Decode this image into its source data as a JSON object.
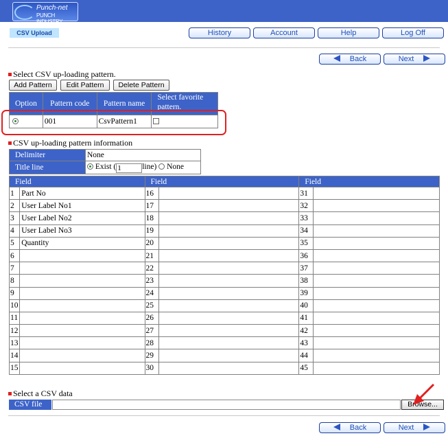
{
  "header": {
    "logo_line1": "Punch-net",
    "logo_line2": "PUNCH INDUSTRY",
    "page_tag": "CSV Upload"
  },
  "nav": {
    "history": "History",
    "account": "Account",
    "help": "Help",
    "logout": "Log Off"
  },
  "pager": {
    "back": "Back",
    "next": "Next"
  },
  "pattern_section": {
    "heading": "Select CSV up-loading pattern.",
    "buttons": {
      "add": "Add Pattern",
      "edit": "Edit Pattern",
      "delete": "Delete Pattern"
    },
    "headers": {
      "option": "Option",
      "code": "Pattern code",
      "name": "Pattern name",
      "favorite": "Select favorite pattern."
    },
    "row": {
      "code": "001",
      "name": "CsvPattern1"
    }
  },
  "info_section": {
    "heading": "CSV up-loading pattern information",
    "delimiter_label": "Delimiter",
    "delimiter_value": "None",
    "title_label": "Title line",
    "exist_label": "Exist (",
    "title_lines": "1",
    "line_suffix": "line)",
    "none_label": "None",
    "field_header": "Field",
    "col1": [
      {
        "n": "1",
        "v": "Part No"
      },
      {
        "n": "2",
        "v": "User Label No1"
      },
      {
        "n": "3",
        "v": "User Label No2"
      },
      {
        "n": "4",
        "v": "User Label No3"
      },
      {
        "n": "5",
        "v": "Quantity"
      },
      {
        "n": "6",
        "v": ""
      },
      {
        "n": "7",
        "v": ""
      },
      {
        "n": "8",
        "v": ""
      },
      {
        "n": "9",
        "v": ""
      },
      {
        "n": "10",
        "v": ""
      },
      {
        "n": "11",
        "v": ""
      },
      {
        "n": "12",
        "v": ""
      },
      {
        "n": "13",
        "v": ""
      },
      {
        "n": "14",
        "v": ""
      },
      {
        "n": "15",
        "v": ""
      }
    ],
    "col2": [
      "16",
      "17",
      "18",
      "19",
      "20",
      "21",
      "22",
      "23",
      "24",
      "25",
      "26",
      "27",
      "28",
      "29",
      "30"
    ],
    "col3": [
      "31",
      "32",
      "33",
      "34",
      "35",
      "36",
      "37",
      "38",
      "39",
      "40",
      "41",
      "42",
      "43",
      "44",
      "45"
    ]
  },
  "csv_section": {
    "heading": "Select a CSV data",
    "file_label": "CSV file",
    "browse": "Browse..."
  },
  "colors": {
    "brand_blue": "#3d63c8",
    "highlight_red": "#e02020",
    "tag_bg": "#bfe5ff"
  }
}
